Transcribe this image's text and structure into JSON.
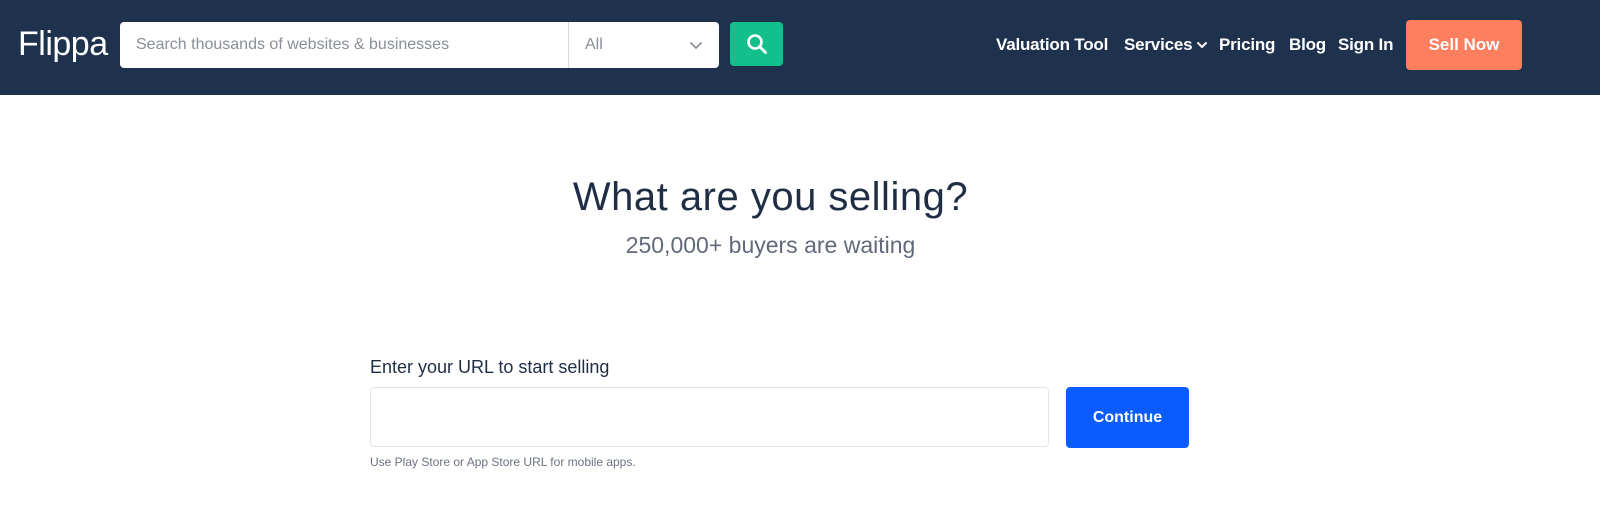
{
  "header": {
    "logo_text": "Flippa",
    "search": {
      "placeholder": "Search thousands of websites & businesses",
      "category_selected": "All",
      "button_icon": "search-icon"
    },
    "nav": {
      "valuation_tool": "Valuation Tool",
      "services": "Services",
      "pricing": "Pricing",
      "blog": "Blog",
      "sign_in": "Sign In"
    },
    "sell_now_label": "Sell Now"
  },
  "hero": {
    "title": "What are you selling?",
    "subtitle": "250,000+ buyers are waiting"
  },
  "form": {
    "label": "Enter your URL to start selling",
    "url_value": "",
    "continue_label": "Continue",
    "hint": "Use Play Store or App Store URL for mobile apps."
  },
  "colors": {
    "header_bg": "#1f324d",
    "search_button": "#13c08b",
    "sell_now": "#fd7f5e",
    "continue": "#0b5cff"
  }
}
